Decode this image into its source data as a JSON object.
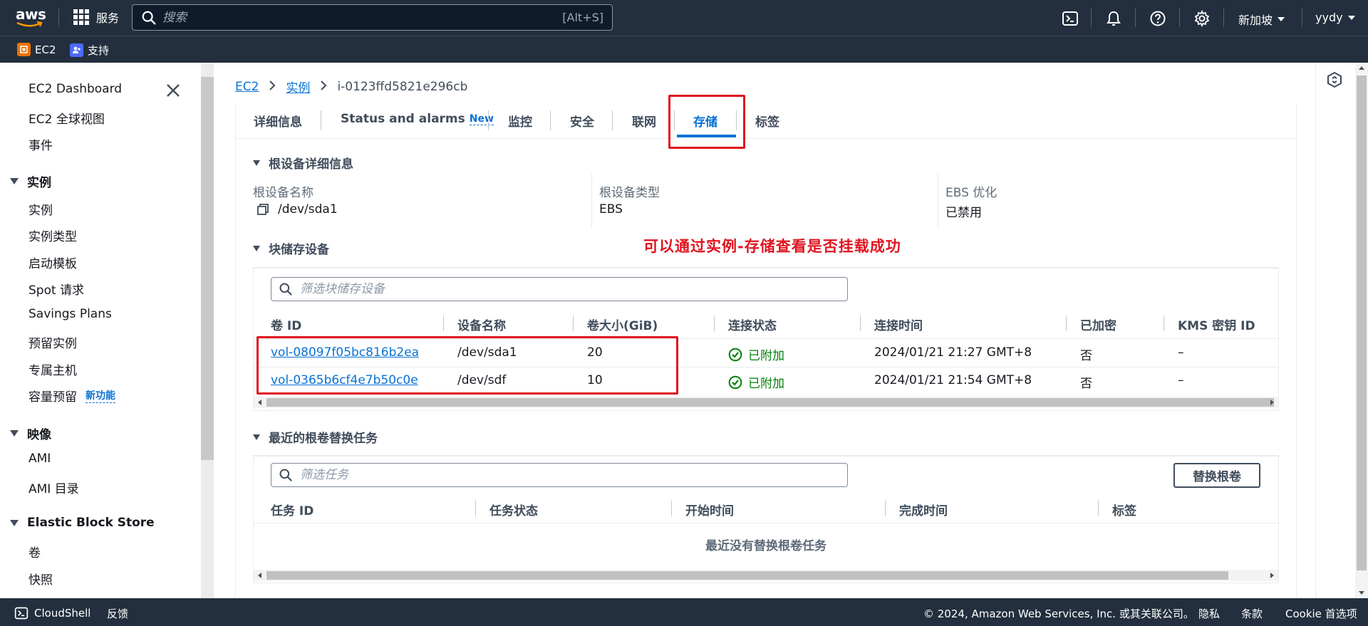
{
  "topnav": {
    "logo_text": "aws",
    "services_label": "服务",
    "search_placeholder": "搜索",
    "search_shortcut": "[Alt+S]",
    "region": "新加坡",
    "user": "yydy"
  },
  "favorites": [
    {
      "label": "EC2",
      "color": "#ed7100"
    },
    {
      "label": "支持",
      "color": "#4d6bfe"
    }
  ],
  "sidebar": {
    "top_items": [
      "EC2 Dashboard",
      "EC2 全球视图",
      "事件"
    ],
    "sections": [
      {
        "title": "实例",
        "items": [
          "实例",
          "实例类型",
          "启动模板",
          "Spot 请求",
          "Savings Plans",
          "预留实例",
          "专属主机",
          "容量预留"
        ],
        "new_badge": "新功能"
      },
      {
        "title": "映像",
        "items": [
          "AMI",
          "AMI 目录"
        ]
      },
      {
        "title": "Elastic Block Store",
        "items": [
          "卷",
          "快照"
        ]
      }
    ]
  },
  "breadcrumb": {
    "items": [
      "EC2",
      "实例"
    ],
    "current": "i-0123ffd5821e296cb"
  },
  "tabs": [
    "详细信息",
    "Status and alarms",
    "监控",
    "安全",
    "联网",
    "存储",
    "标签"
  ],
  "tab_new_badge": "New",
  "active_tab": "存储",
  "root_device": {
    "title": "根设备详细信息",
    "name_label": "根设备名称",
    "name_value": "/dev/sda1",
    "type_label": "根设备类型",
    "type_value": "EBS",
    "ebs_label": "EBS 优化",
    "ebs_value": "已禁用"
  },
  "annotation": "可以通过实例-存储查看是否挂载成功",
  "block_devices": {
    "title": "块储存设备",
    "filter_placeholder": "筛选块储存设备",
    "columns": [
      "卷 ID",
      "设备名称",
      "卷大小(GiB)",
      "连接状态",
      "连接时间",
      "已加密",
      "KMS 密钥 ID"
    ],
    "rows": [
      {
        "volume_id": "vol-08097f05bc816b2ea",
        "device": "/dev/sda1",
        "size": "20",
        "status": "已附加",
        "time": "2024/01/21 21:27 GMT+8",
        "encrypted": "否",
        "kms": "–"
      },
      {
        "volume_id": "vol-0365b6cf4e7b50c0e",
        "device": "/dev/sdf",
        "size": "10",
        "status": "已附加",
        "time": "2024/01/21 21:54 GMT+8",
        "encrypted": "否",
        "kms": "–"
      }
    ]
  },
  "root_replace": {
    "title": "最近的根卷替换任务",
    "filter_placeholder": "筛选任务",
    "button": "替换根卷",
    "columns": [
      "任务 ID",
      "任务状态",
      "开始时间",
      "完成时间",
      "标签"
    ],
    "empty": "最近没有替换根卷任务"
  },
  "footer": {
    "cloudshell": "CloudShell",
    "feedback": "反馈",
    "copyright": "© 2024, Amazon Web Services, Inc. 或其关联公司。",
    "privacy": "隐私",
    "terms": "条款",
    "cookie": "Cookie 首选项"
  },
  "colors": {
    "nav_bg": "#232f3e",
    "link": "#0972d3",
    "success": "#037f0c",
    "annotation": "#e0141f"
  }
}
